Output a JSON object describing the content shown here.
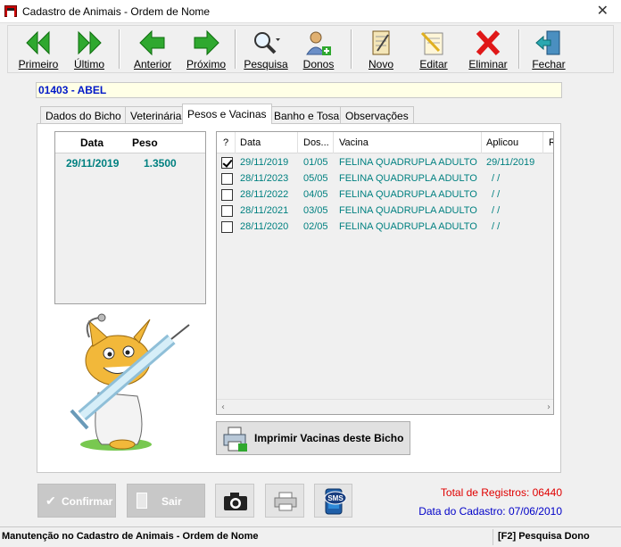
{
  "window": {
    "title": "Cadastro de Animais - Ordem de Nome"
  },
  "toolbar": {
    "items": [
      {
        "label": "Primeiro",
        "icon": "first-record-icon"
      },
      {
        "label": "Último",
        "icon": "last-record-icon"
      },
      {
        "label": "Anterior",
        "icon": "previous-record-icon"
      },
      {
        "label": "Próximo",
        "icon": "next-record-icon"
      },
      {
        "label": "Pesquisa",
        "icon": "search-icon"
      },
      {
        "label": "Donos",
        "icon": "owners-icon"
      },
      {
        "label": "Novo",
        "icon": "new-record-icon"
      },
      {
        "label": "Editar",
        "icon": "edit-icon"
      },
      {
        "label": "Eliminar",
        "icon": "delete-icon"
      },
      {
        "label": "Fechar",
        "icon": "exit-door-icon"
      }
    ]
  },
  "record": {
    "title": "01403 - ABEL"
  },
  "tabs": [
    {
      "label": "Dados do Bicho"
    },
    {
      "label": "Veterinária"
    },
    {
      "label": "Pesos e Vacinas",
      "active": true
    },
    {
      "label": "Banho e Tosa"
    },
    {
      "label": "Observações"
    }
  ],
  "weights": {
    "headers": [
      "Data",
      "Peso"
    ],
    "rows": [
      {
        "date": "29/11/2019",
        "weight": "1.3500"
      }
    ]
  },
  "vaccines": {
    "headers": [
      "?",
      "Data",
      "Dos...",
      "Vacina",
      "Aplicou",
      "R"
    ],
    "rows": [
      {
        "checked": true,
        "date": "29/11/2019",
        "dose": "01/05",
        "vaccine": "FELINA QUADRUPLA ADULTO",
        "applied": "29/11/2019"
      },
      {
        "checked": false,
        "date": "28/11/2023",
        "dose": "05/05",
        "vaccine": "FELINA QUADRUPLA ADULTO",
        "applied": "/  /"
      },
      {
        "checked": false,
        "date": "28/11/2022",
        "dose": "04/05",
        "vaccine": "FELINA QUADRUPLA ADULTO",
        "applied": "/  /"
      },
      {
        "checked": false,
        "date": "28/11/2021",
        "dose": "03/05",
        "vaccine": "FELINA QUADRUPLA ADULTO",
        "applied": "/  /"
      },
      {
        "checked": false,
        "date": "28/11/2020",
        "dose": "02/05",
        "vaccine": "FELINA QUADRUPLA ADULTO",
        "applied": "/  /"
      }
    ]
  },
  "print_vaccines_label": "Imprimir Vacinas deste Bicho",
  "buttons": {
    "confirm": "Confirmar",
    "exit": "Sair"
  },
  "totals": {
    "records": "Total de Registros: 06440",
    "registered": "Data do Cadastro: 07/06/2010"
  },
  "status": {
    "left": "Manutenção no Cadastro de Animais - Ordem de Nome",
    "right": "[F2] Pesquisa Dono"
  },
  "colors": {
    "nav_green": "#2fa82f",
    "record_text": "#0018c8",
    "grid_text": "#008080",
    "total_red": "#e00000",
    "date_blue": "#0000c8"
  }
}
